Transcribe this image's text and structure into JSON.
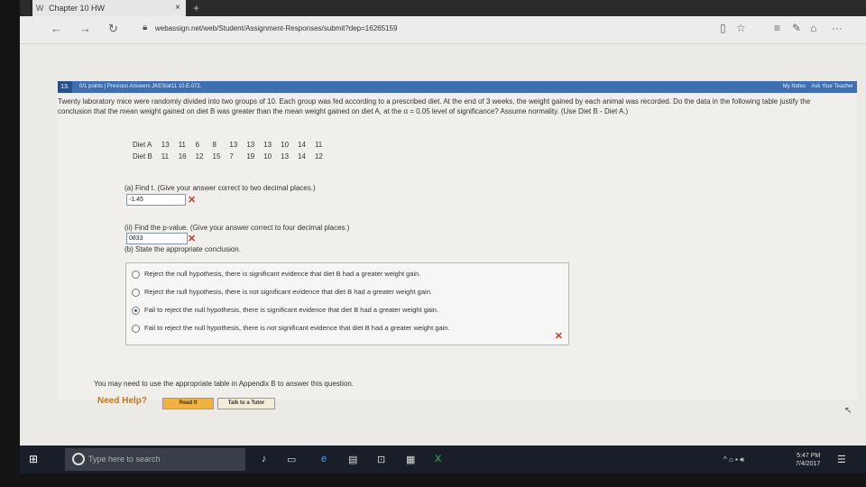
{
  "tab": {
    "title": "Chapter 10 HW",
    "close": "×",
    "newtab": "+"
  },
  "address": {
    "url": "webassign.net/web/Student/Assignment-Responses/submit?dep=16265159"
  },
  "question": {
    "number": "13.",
    "header_info": "0/1 points  |  Previous Answers   JKEStat11 10.E.072.",
    "my_notes": "My Notes",
    "ask_teacher": "Ask Your Teacher",
    "text": "Twenty laboratory mice were randomly divided into two groups of 10. Each group was fed according to a prescribed diet. At the end of 3 weeks, the weight gained by each animal was recorded. Do the data in the following table justify the conclusion that the mean weight gained on diet B was greater than the mean weight gained on diet A, at the α = 0.05 level of significance? Assume normality. (Use Diet B - Diet A.)",
    "table": {
      "rows": [
        {
          "label": "Diet A",
          "values": [
            "13",
            "11",
            "6",
            "8",
            "13",
            "13",
            "13",
            "10",
            "14",
            "11"
          ]
        },
        {
          "label": "Diet B",
          "values": [
            "11",
            "16",
            "12",
            "15",
            "7",
            "19",
            "10",
            "13",
            "14",
            "12"
          ]
        }
      ]
    },
    "part_a": {
      "prompt": "(a) Find t. (Give your answer correct to two decimal places.)",
      "answer": "-1.45",
      "mark": "✕"
    },
    "part_aii": {
      "prompt": "(ii) Find the p-value. (Give your answer correct to four decimal places.)",
      "answer": "0833",
      "mark": "✕"
    },
    "part_b": {
      "prompt": "(b) State the appropriate conclusion.",
      "options": [
        "Reject the null hypothesis, there is significant evidence that diet B had a greater weight gain.",
        "Reject the null hypothesis, there is not significant evidence that diet B had a greater weight gain.",
        "Fail to reject the null hypothesis, there is significant evidence that diet B had a greater weight gain.",
        "Fail to reject the null hypothesis, there is not significant evidence that diet B had a greater weight gain."
      ],
      "selected_index": 2,
      "mark": "✕"
    },
    "appendix_note": "You may need to use the appropriate table in Appendix B to answer this question.",
    "need_help": "Need Help?",
    "read_it": "Read It",
    "talk_tutor": "Talk to a Tutor"
  },
  "taskbar": {
    "search_placeholder": "Type here to search",
    "time": "5:47 PM",
    "date": "7/4/2017"
  }
}
